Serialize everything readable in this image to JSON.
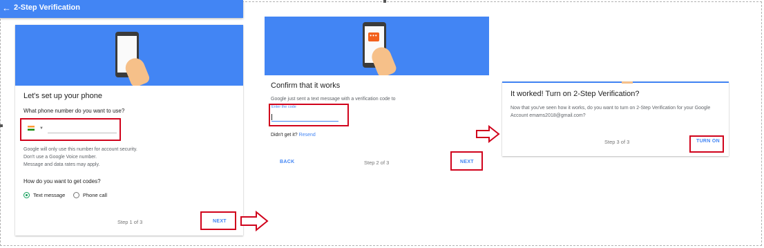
{
  "appbar": {
    "back_glyph": "←",
    "title": "2-Step Verification"
  },
  "panel1": {
    "heading": "Let's set up your phone",
    "question": "What phone number do you want to use?",
    "country_flag": "india-flag-icon",
    "phone_value": "",
    "notes": [
      "Google will only use this number for account security.",
      "Don't use a Google Voice number.",
      "Message and data rates may apply."
    ],
    "codes_question": "How do you want to get codes?",
    "option_text": "Text message",
    "option_call": "Phone call",
    "selected_option": "Text message",
    "step": "Step 1 of 3",
    "next": "NEXT"
  },
  "panel2": {
    "heading": "Confirm that it works",
    "desc": "Google just sent a text message with a verification code to",
    "code_label": "Enter the code",
    "code_value": "",
    "didnt_get": "Didn't get it?",
    "resend": "Resend",
    "back": "BACK",
    "step": "Step 2 of 3",
    "next": "NEXT",
    "bubble_glyph": "•••"
  },
  "panel3": {
    "heading": "It worked! Turn on 2-Step Verification?",
    "desc_line1": "Now that you've seen how it works, do you want to turn on 2-Step Verification for your Google",
    "desc_line2": "Account emams2018@gmail.com?",
    "step": "Step 3 of 3",
    "turn_on": "TURN ON"
  },
  "colors": {
    "brand_blue": "#4285f4",
    "highlight_red": "#d0021b",
    "radio_green": "#0f9d58",
    "skin": "#f6c089",
    "sms_orange": "#f2611d"
  }
}
